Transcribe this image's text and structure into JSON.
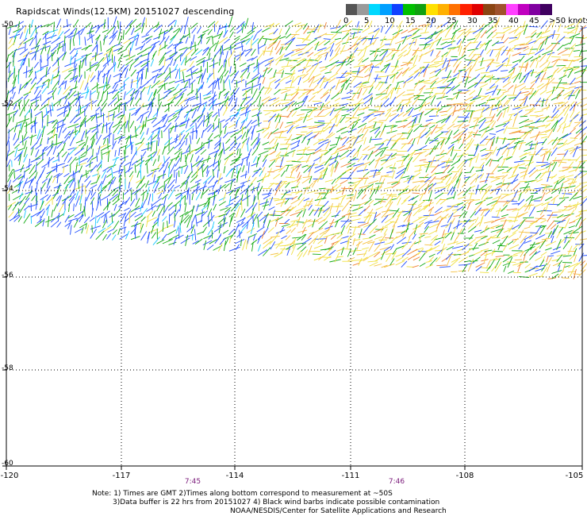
{
  "title": "Rapidscat Winds(12.5KM) 20151027 descending",
  "legend": {
    "colors": [
      "#555555",
      "#9a9a9a",
      "#00d8ff",
      "#00a0ff",
      "#1040ff",
      "#00c000",
      "#10a010",
      "#ffe000",
      "#ffb000",
      "#ff7000",
      "#ff2000",
      "#e00000",
      "#8b4513",
      "#a0522d",
      "#ff40ff",
      "#c000c0",
      "#8000a0",
      "#400060"
    ],
    "labels": [
      "0",
      "5",
      "10",
      "15",
      "20",
      "25",
      "30",
      "35",
      "40",
      "45",
      ">50 knots"
    ]
  },
  "axes": {
    "x_ticks": [
      "-120",
      "-117",
      "-114",
      "-111",
      "-108",
      "-105"
    ],
    "y_ticks": [
      "-50",
      "-52",
      "-54",
      "-56",
      "-58",
      "-60"
    ],
    "lon_range": [
      -120,
      -105
    ],
    "lat_range": [
      -60,
      -50
    ]
  },
  "times": [
    "7:45",
    "7:46"
  ],
  "notes": {
    "line1": "Note: 1) Times are GMT 2)Times along bottom correspond to measurement at ~50S",
    "line2": "3)Data buffer is 22 hrs from 20151027 4) Black wind barbs indicate possible contamination",
    "line3": "NOAA/NESDIS/Center for Satellite Applications and Research"
  }
}
